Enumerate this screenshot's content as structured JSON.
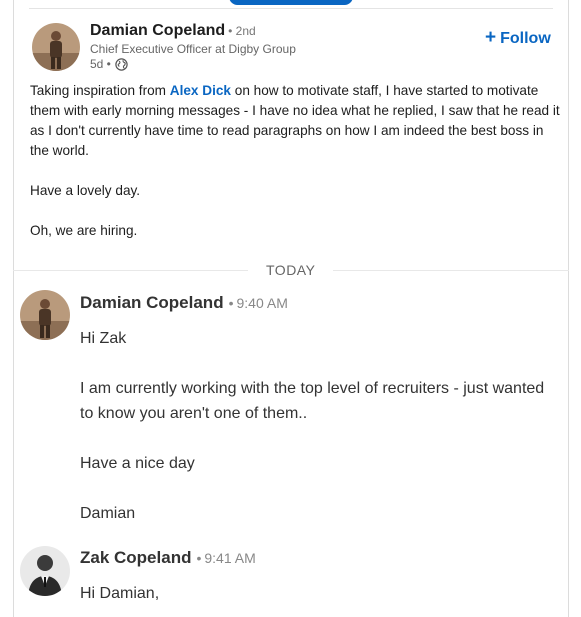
{
  "post": {
    "author_name": "Damian Copeland",
    "degree": "• 2nd",
    "author_title": "Chief Executive Officer at Digby Group",
    "age": "5d •",
    "follow_label": "Follow",
    "body": {
      "line1_prefix": "Taking inspiration from ",
      "mention": "Alex Dick",
      "line1_suffix": " on how to motivate staff, I have started to motivate them with early morning messages - I have no idea what he replied, I saw that he read it as I don't currently have time to read paragraphs on how I am indeed the best boss in the world.",
      "para2": "Have a lovely day.",
      "para3": "Oh, we are hiring."
    }
  },
  "divider_label": "TODAY",
  "messages": [
    {
      "sender": "Damian Copeland",
      "time": "9:40 AM",
      "paragraphs": [
        "Hi Zak",
        "I am currently working with the top level of recruiters - just wanted to know you aren't one of them..",
        "Have a nice day",
        "Damian"
      ]
    },
    {
      "sender": "Zak Copeland",
      "time": "9:41 AM",
      "paragraphs": [
        "Hi Damian,"
      ]
    }
  ]
}
